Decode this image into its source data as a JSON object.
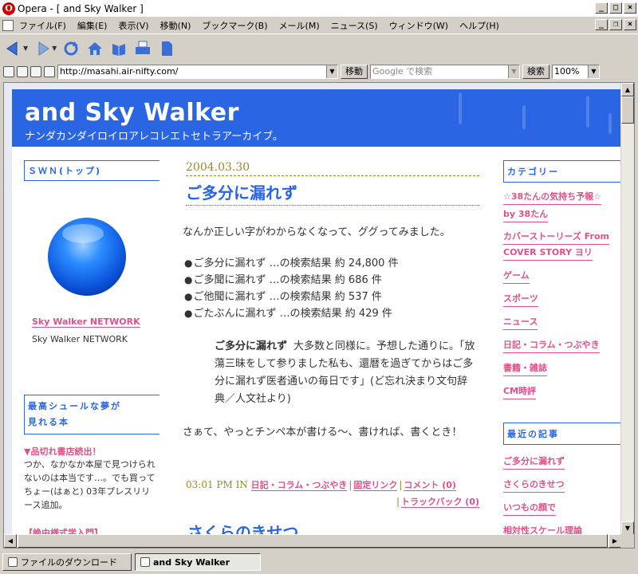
{
  "window": {
    "title": "Opera - [ and Sky Walker ]",
    "app_icon": "opera-o-icon",
    "controls": [
      "minimize",
      "maximize",
      "close"
    ]
  },
  "menu": {
    "items": [
      "ファイル(F)",
      "編集(E)",
      "表示(V)",
      "移動(N)",
      "ブックマーク(B)",
      "メール(M)",
      "ニュース(S)",
      "ウィンドウ(W)",
      "ヘルプ(H)"
    ]
  },
  "toolbar": {
    "buttons": [
      "back-icon",
      "forward-icon",
      "reload-icon",
      "home-icon",
      "bookmarks-icon",
      "print-icon",
      "page-icon"
    ]
  },
  "address": {
    "url": "http://masahi.air-nifty.com/",
    "go_label": "移動",
    "search_placeholder": "Google で検索",
    "search_label": "検索",
    "zoom": "100%"
  },
  "site": {
    "title": "and Sky Walker",
    "subtitle": "ナンダカンダイロイロアレコレエトセトラアーカイブ。"
  },
  "left": {
    "swn_heading": "ＳＷＮ(トップ)",
    "network_link": "Sky Walker NETWORK",
    "network_caption": "Sky Walker NETWORK",
    "best_heading_line1": "最高シュールな夢が",
    "best_heading_line2": "見れる本",
    "headline": "▼品切れ書店続出！",
    "text": "つか、なかなか本屋で見つけられないのは本当です…。でも買ってちょー(はぁと) 03年プレスリリース追加。",
    "cut_headline": "【絶由様式学入門】"
  },
  "post": {
    "date": "2004.03.30",
    "title": "ご多分に漏れず",
    "intro": "なんか正しい字がわからなくなって、ググってみました。",
    "results": [
      {
        "term": "ご多分に漏れず",
        "text": "…の検索結果 約",
        "count": "24,800",
        "unit": "件"
      },
      {
        "term": "ご多聞に漏れず",
        "text": "…の検索結果 約",
        "count": "686",
        "unit": "件"
      },
      {
        "term": "ご他聞に漏れず",
        "text": "…の検索結果 約",
        "count": "537",
        "unit": "件"
      },
      {
        "term": "ごたぶんに漏れず",
        "text": "…の検索結果 約",
        "count": "429",
        "unit": "件"
      }
    ],
    "quote_term": "ご多分に漏れず",
    "quote_text": "大多数と同様に。予想した通りに。「放蕩三昧をして参りました私も、還暦を過ぎてからはご多分に漏れず医者通いの毎日です」(ど忘れ決まり文句辞典／人文社より)",
    "outro": "さぁて、やっとチンペ本が書ける〜、書ければ、書くとき！",
    "time": "03:01 PM IN",
    "category_link": "日記・コラム・つぶやき",
    "permalink": "固定リンク",
    "comment_link": "コメント (0)",
    "trackback_link": "トラックバック (0)",
    "next_title": "さくらのきせつ"
  },
  "right": {
    "category_heading": "カテゴリー",
    "categories": [
      "☆38たんの気持ち予報☆",
      "by 38たん",
      "カバーストーリーズ From",
      "COVER STORY ヨリ",
      "ゲーム",
      "スポーツ",
      "ニュース",
      "日記・コラム・つぶやき",
      "書籍・雑誌",
      "CM時評"
    ],
    "recent_heading": "最近の記事",
    "recent": [
      "ご多分に漏れず",
      "さくらのきせつ",
      "いつもの顔で",
      "相対性スケール理論"
    ]
  },
  "status": {
    "download_tab": "ファイルのダウンロード",
    "page_tab": "and Sky Walker"
  },
  "colors": {
    "brand_blue": "#2a66e4",
    "link_pink": "#e0508a",
    "date_olive": "#9a8a2a"
  }
}
